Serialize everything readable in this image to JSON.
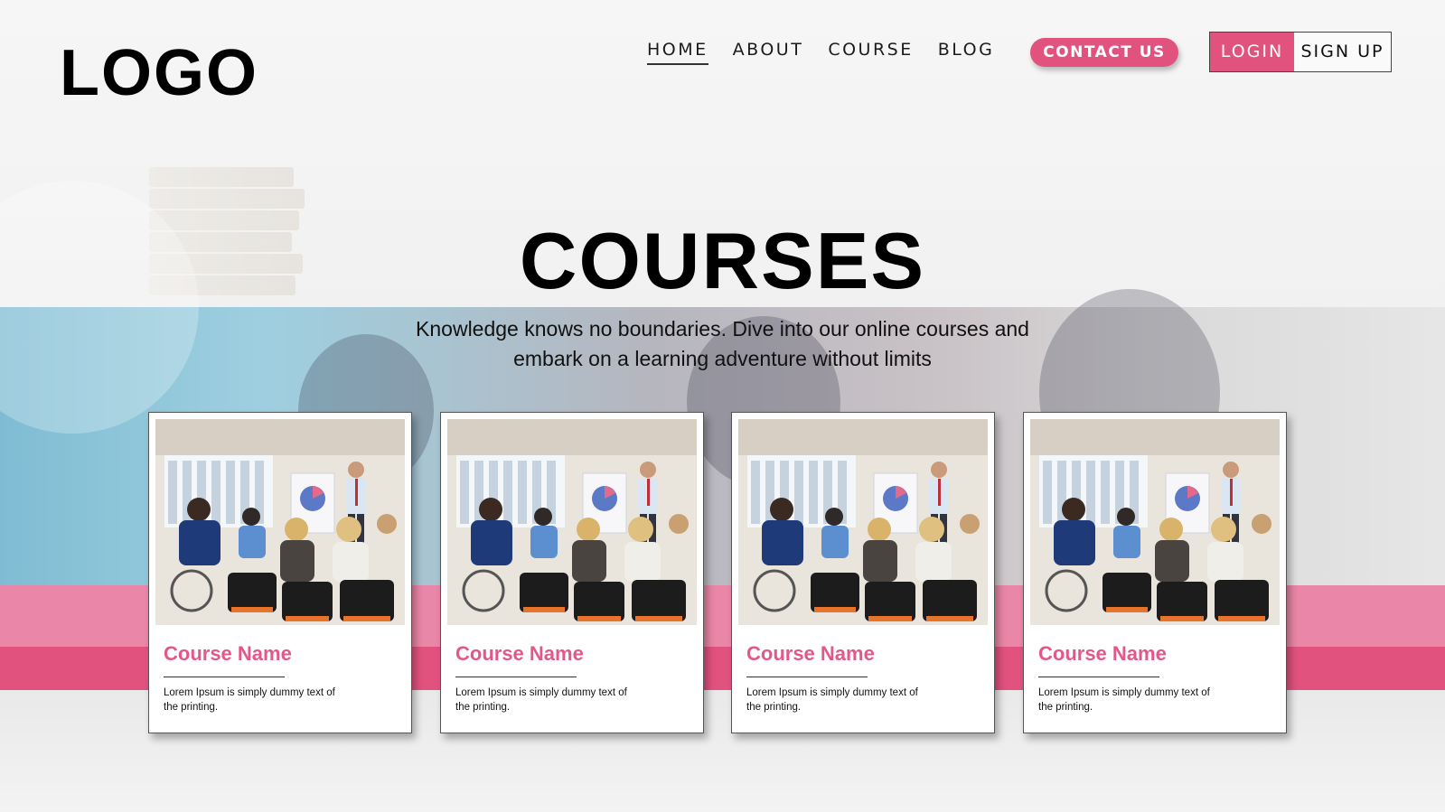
{
  "header": {
    "logo": "LOGO",
    "nav": [
      {
        "label": "HOME",
        "active": true
      },
      {
        "label": "ABOUT",
        "active": false
      },
      {
        "label": "COURSE",
        "active": false
      },
      {
        "label": "BLOG",
        "active": false
      }
    ],
    "contact_label": "CONTACT US",
    "login_label": "LOGIN",
    "signup_label": "SIGN UP"
  },
  "hero": {
    "title": "COURSES",
    "subtitle_line1": "Knowledge knows no boundaries. Dive into our online courses and",
    "subtitle_line2": "embark on a learning adventure without limits"
  },
  "courses": [
    {
      "name": "Course Name",
      "desc_line1": "Lorem Ipsum is simply dummy text of",
      "desc_line2": "the printing.",
      "image": "classroom-photo"
    },
    {
      "name": "Course Name",
      "desc_line1": "Lorem Ipsum is simply dummy text of",
      "desc_line2": "the printing.",
      "image": "classroom-photo"
    },
    {
      "name": "Course Name",
      "desc_line1": "Lorem Ipsum is simply dummy text of",
      "desc_line2": "the printing.",
      "image": "classroom-photo"
    },
    {
      "name": "Course Name",
      "desc_line1": "Lorem Ipsum is simply dummy text of",
      "desc_line2": "the printing.",
      "image": "classroom-photo"
    }
  ],
  "colors": {
    "accent_pink": "#e2527f",
    "light_pink": "#ea86a7",
    "course_name": "#e2588a"
  }
}
